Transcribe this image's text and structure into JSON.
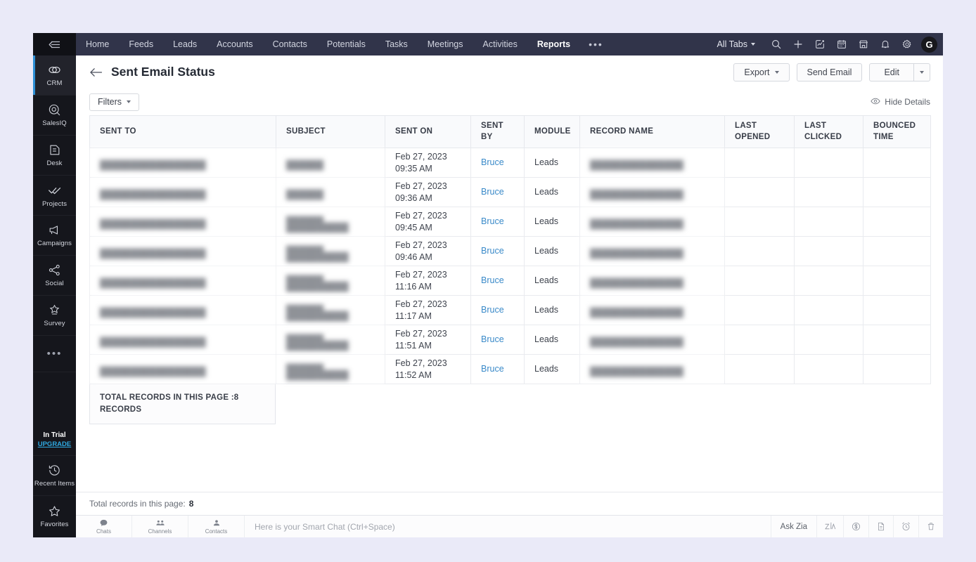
{
  "sidebar": {
    "collapse_icon": "collapse-icon",
    "items": [
      {
        "label": "CRM",
        "icon": "crm-icon",
        "active": true
      },
      {
        "label": "SalesIQ",
        "icon": "salesiq-icon",
        "active": false
      },
      {
        "label": "Desk",
        "icon": "desk-icon",
        "active": false
      },
      {
        "label": "Projects",
        "icon": "projects-icon",
        "active": false
      },
      {
        "label": "Campaigns",
        "icon": "campaigns-icon",
        "active": false
      },
      {
        "label": "Social",
        "icon": "social-icon",
        "active": false
      },
      {
        "label": "Survey",
        "icon": "survey-icon",
        "active": false
      }
    ],
    "more_label": "•••",
    "trial_label": "In Trial",
    "upgrade_label": "UPGRADE",
    "recent_items_label": "Recent Items",
    "favorites_label": "Favorites"
  },
  "topnav": {
    "links": [
      {
        "label": "Home",
        "active": false
      },
      {
        "label": "Feeds",
        "active": false
      },
      {
        "label": "Leads",
        "active": false
      },
      {
        "label": "Accounts",
        "active": false
      },
      {
        "label": "Contacts",
        "active": false
      },
      {
        "label": "Potentials",
        "active": false
      },
      {
        "label": "Tasks",
        "active": false
      },
      {
        "label": "Meetings",
        "active": false
      },
      {
        "label": "Activities",
        "active": false
      },
      {
        "label": "Reports",
        "active": true
      }
    ],
    "overflow_label": "•••",
    "all_tabs_label": "All Tabs",
    "icons": [
      "search-icon",
      "plus-icon",
      "analytics-icon",
      "calendar-icon",
      "marketplace-icon",
      "bell-icon",
      "gear-icon"
    ],
    "avatar_letter": "G"
  },
  "header": {
    "back_icon": "back-arrow-icon",
    "title": "Sent Email Status",
    "export_label": "Export",
    "send_email_label": "Send Email",
    "edit_label": "Edit"
  },
  "toolbar": {
    "filters_label": "Filters",
    "hide_details_label": "Hide Details",
    "eye_icon": "eye-icon"
  },
  "table": {
    "columns": [
      "SENT TO",
      "SUBJECT",
      "SENT ON",
      "SENT BY",
      "MODULE",
      "RECORD NAME",
      "LAST OPENED",
      "LAST CLICKED",
      "BOUNCED TIME"
    ],
    "rows": [
      {
        "sent_to": "",
        "subject": "",
        "sent_on": "Feb 27, 2023\n09:35 AM",
        "sent_by": "Bruce",
        "module": "Leads",
        "record_name": "",
        "last_opened": "",
        "last_clicked": "",
        "bounced_time": "",
        "subject_lines": 1
      },
      {
        "sent_to": "",
        "subject": "",
        "sent_on": "Feb 27, 2023\n09:36 AM",
        "sent_by": "Bruce",
        "module": "Leads",
        "record_name": "",
        "last_opened": "",
        "last_clicked": "",
        "bounced_time": "",
        "subject_lines": 1
      },
      {
        "sent_to": "",
        "subject": "",
        "sent_on": "Feb 27, 2023\n09:45 AM",
        "sent_by": "Bruce",
        "module": "Leads",
        "record_name": "",
        "last_opened": "",
        "last_clicked": "",
        "bounced_time": "",
        "subject_lines": 2
      },
      {
        "sent_to": "",
        "subject": "",
        "sent_on": "Feb 27, 2023\n09:46 AM",
        "sent_by": "Bruce",
        "module": "Leads",
        "record_name": "",
        "last_opened": "",
        "last_clicked": "",
        "bounced_time": "",
        "subject_lines": 2
      },
      {
        "sent_to": "",
        "subject": "",
        "sent_on": "Feb 27, 2023\n11:16 AM",
        "sent_by": "Bruce",
        "module": "Leads",
        "record_name": "",
        "last_opened": "",
        "last_clicked": "",
        "bounced_time": "",
        "subject_lines": 2
      },
      {
        "sent_to": "",
        "subject": "",
        "sent_on": "Feb 27, 2023\n11:17 AM",
        "sent_by": "Bruce",
        "module": "Leads",
        "record_name": "",
        "last_opened": "",
        "last_clicked": "",
        "bounced_time": "",
        "subject_lines": 2
      },
      {
        "sent_to": "",
        "subject": "",
        "sent_on": "Feb 27, 2023\n11:51 AM",
        "sent_by": "Bruce",
        "module": "Leads",
        "record_name": "",
        "last_opened": "",
        "last_clicked": "",
        "bounced_time": "",
        "subject_lines": 2
      },
      {
        "sent_to": "",
        "subject": "",
        "sent_on": "Feb 27, 2023\n11:52 AM",
        "sent_by": "Bruce",
        "module": "Leads",
        "record_name": "",
        "last_opened": "",
        "last_clicked": "",
        "bounced_time": "",
        "subject_lines": 2
      }
    ],
    "total_box_label": "TOTAL RECORDS IN THIS PAGE :8 RECORDS"
  },
  "statusbar": {
    "total_label": "Total records in this page:",
    "total_value": "8"
  },
  "chatbar": {
    "tabs": [
      {
        "label": "Chats",
        "icon": "chat-bubble-icon"
      },
      {
        "label": "Channels",
        "icon": "channels-icon"
      },
      {
        "label": "Contacts",
        "icon": "person-icon"
      }
    ],
    "placeholder": "Here is your Smart Chat (Ctrl+Space)",
    "ask_zia_label": "Ask Zia",
    "right_icons": [
      "zia-icon",
      "currency-icon",
      "document-icon",
      "alarm-icon",
      "trash-icon"
    ]
  }
}
